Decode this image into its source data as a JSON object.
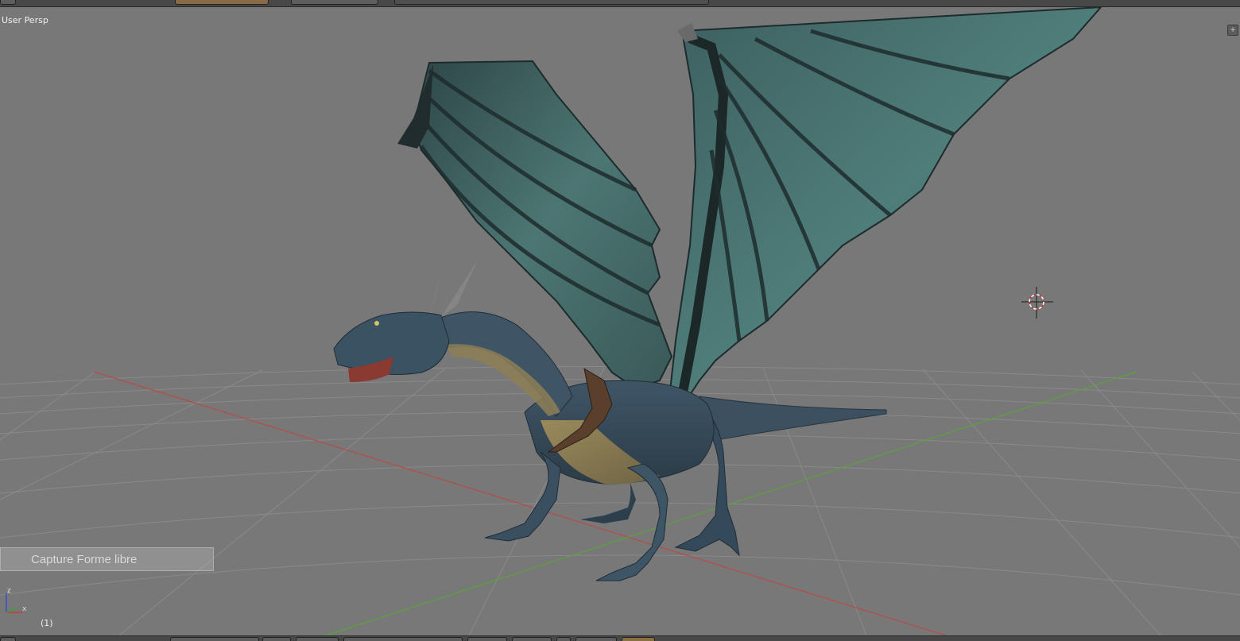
{
  "viewport": {
    "view_label": "User Persp",
    "frame_label": "(1)",
    "capture_overlay_text": "Capture Forme libre",
    "axis_gizmo": {
      "z_label": "z",
      "x_label": "x"
    },
    "corner_widget_icon": "plus-icon",
    "cursor_icon": "3d-cursor-icon",
    "colors": {
      "background": "#787878",
      "grid": "#8a8a8a",
      "x_axis": "#b84a4a",
      "y_axis": "#5aa33a",
      "header": "#484848"
    }
  }
}
